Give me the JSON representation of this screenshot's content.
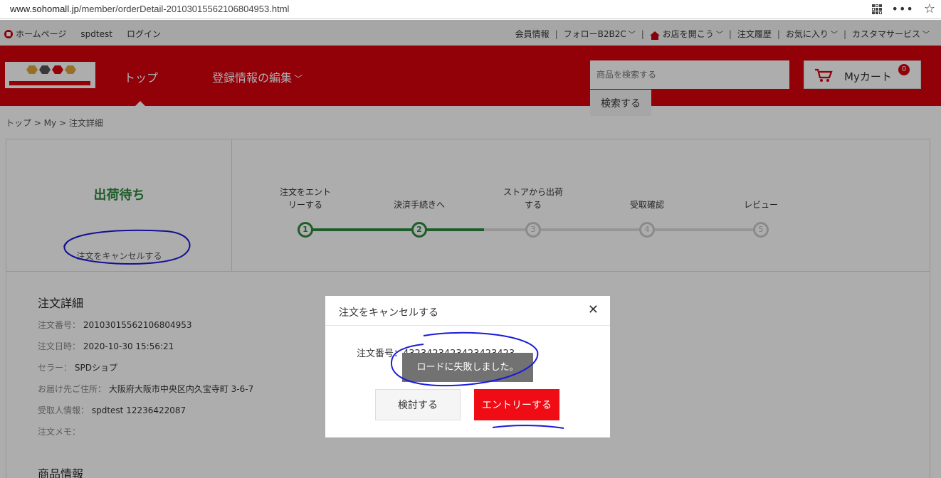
{
  "browser": {
    "url_host": "www.sohomall.jp",
    "url_path": "/member/orderDetail-20103015562106804953.html"
  },
  "topbar": {
    "home": "ホームページ",
    "user": "spdtest",
    "login": "ログイン",
    "member_info": "会員情報",
    "follow": "フォローB2B2C",
    "open_shop": "お店を開こう",
    "order_history": "注文履歴",
    "favorites": "お気に入り",
    "customer_service": "カスタマサービス"
  },
  "header": {
    "logo_alt": "ソーホーモール",
    "nav_top": "トップ",
    "nav_register": "登録情報の編集",
    "search_placeholder": "商品を検索する",
    "search_button": "検索する",
    "cart_label": "Myカート",
    "cart_count": "0"
  },
  "breadcrumb": "トップ > My > 注文詳細",
  "status": {
    "title": "出荷待ち",
    "cancel_link": "注文をキャンセルする"
  },
  "steps": [
    {
      "label": "注文をエント\nリーする",
      "num": "1",
      "done": true
    },
    {
      "label": "決済手続きへ",
      "num": "2",
      "done": true
    },
    {
      "label": "ストアから出荷\nする",
      "num": "3",
      "done": false
    },
    {
      "label": "受取確認",
      "num": "4",
      "done": false
    },
    {
      "label": "レビュー",
      "num": "5",
      "done": false
    }
  ],
  "details": {
    "title": "注文詳細",
    "order_no_label": "注文番号：",
    "order_no": "20103015562106804953",
    "order_date_label": "注文日時：",
    "order_date": "2020-10-30 15:56:21",
    "seller_label": "セラー：",
    "seller": "SPDショプ",
    "address_label": "お届け先ご住所：",
    "address": "大阪府大阪市中央区内久宝寺町 3-6-7",
    "recipient_label": "受取人情報：",
    "recipient": "spdtest 12236422087",
    "memo_label": "注文メモ：",
    "products_title": "商品情報"
  },
  "modal": {
    "title": "注文をキャンセルする",
    "order_label": "注文番号：4323423423423423423",
    "toast": "ロードに失敗しました。",
    "review_button": "検討する",
    "entry_button": "エントリーする"
  },
  "colors": {
    "brand_red": "#d8000d",
    "status_green": "#2d8a3f",
    "button_red": "#f00c15",
    "annotation_blue": "#1a1adb"
  }
}
